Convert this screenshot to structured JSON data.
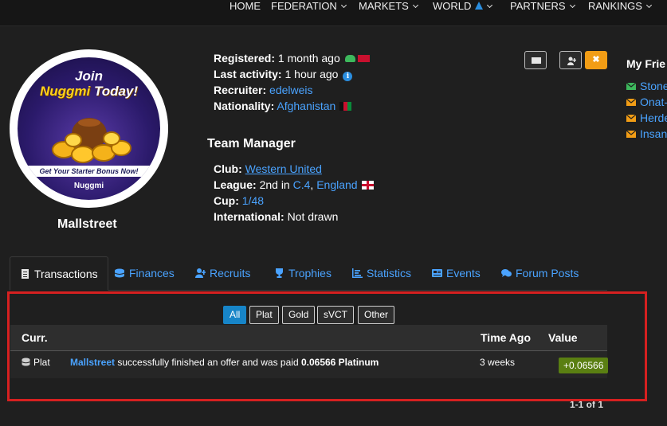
{
  "nav": {
    "home": "HOME",
    "federation": "FEDERATION",
    "markets": "MARKETS",
    "world": "WORLD",
    "partners": "PARTNERS",
    "rankings": "RANKINGS"
  },
  "ad": {
    "line1": "Join",
    "line2_brand": "Nuggmi",
    "line2_rest": "Today!",
    "strip": "Get Your Starter Bonus Now!",
    "brand": "Nuggmi",
    "accent_color": "#ffd21a"
  },
  "profile": {
    "username": "Mallstreet",
    "registered_label": "Registered:",
    "registered_value": "1 month ago",
    "last_activity_label": "Last activity:",
    "last_activity_value": "1 hour ago",
    "recruiter_label": "Recruiter:",
    "recruiter_value": "edelweis",
    "nationality_label": "Nationality:",
    "nationality_value": "Afghanistan"
  },
  "team": {
    "title": "Team Manager",
    "club_label": "Club:",
    "club_value": "Western United",
    "league_label": "League:",
    "league_pos": "2nd in",
    "league_div": "C.4",
    "league_sep": ",",
    "league_country": "England",
    "cup_label": "Cup:",
    "cup_value": "1/48",
    "international_label": "International:",
    "international_value": "Not drawn"
  },
  "actions": {
    "close_symbol": "✖"
  },
  "friends": {
    "title": "My Frie",
    "items": [
      "Stone",
      "Onat-",
      "Herde",
      "Insan"
    ]
  },
  "tabs": [
    {
      "label": "Transactions"
    },
    {
      "label": "Finances"
    },
    {
      "label": "Recruits"
    },
    {
      "label": "Trophies"
    },
    {
      "label": "Statistics"
    },
    {
      "label": "Events"
    },
    {
      "label": "Forum Posts"
    }
  ],
  "filters": [
    "All",
    "Plat",
    "Gold",
    "sVCT",
    "Other"
  ],
  "table": {
    "headers": {
      "curr": "Curr.",
      "time": "Time Ago",
      "value": "Value"
    },
    "rows": [
      {
        "curr": "Plat",
        "user": "Mallstreet",
        "desc": "successfully finished an offer and was paid",
        "amount": "0.06566 Platinum",
        "time": "3 weeks",
        "value": "+0.06566"
      }
    ]
  },
  "pager": "1-1 of 1",
  "colors": {
    "link": "#4aa3ff",
    "highlight_box": "#d62020",
    "active_filter": "#1785c8",
    "value_badge": "#5a7f12",
    "close_button": "#f29d15"
  }
}
